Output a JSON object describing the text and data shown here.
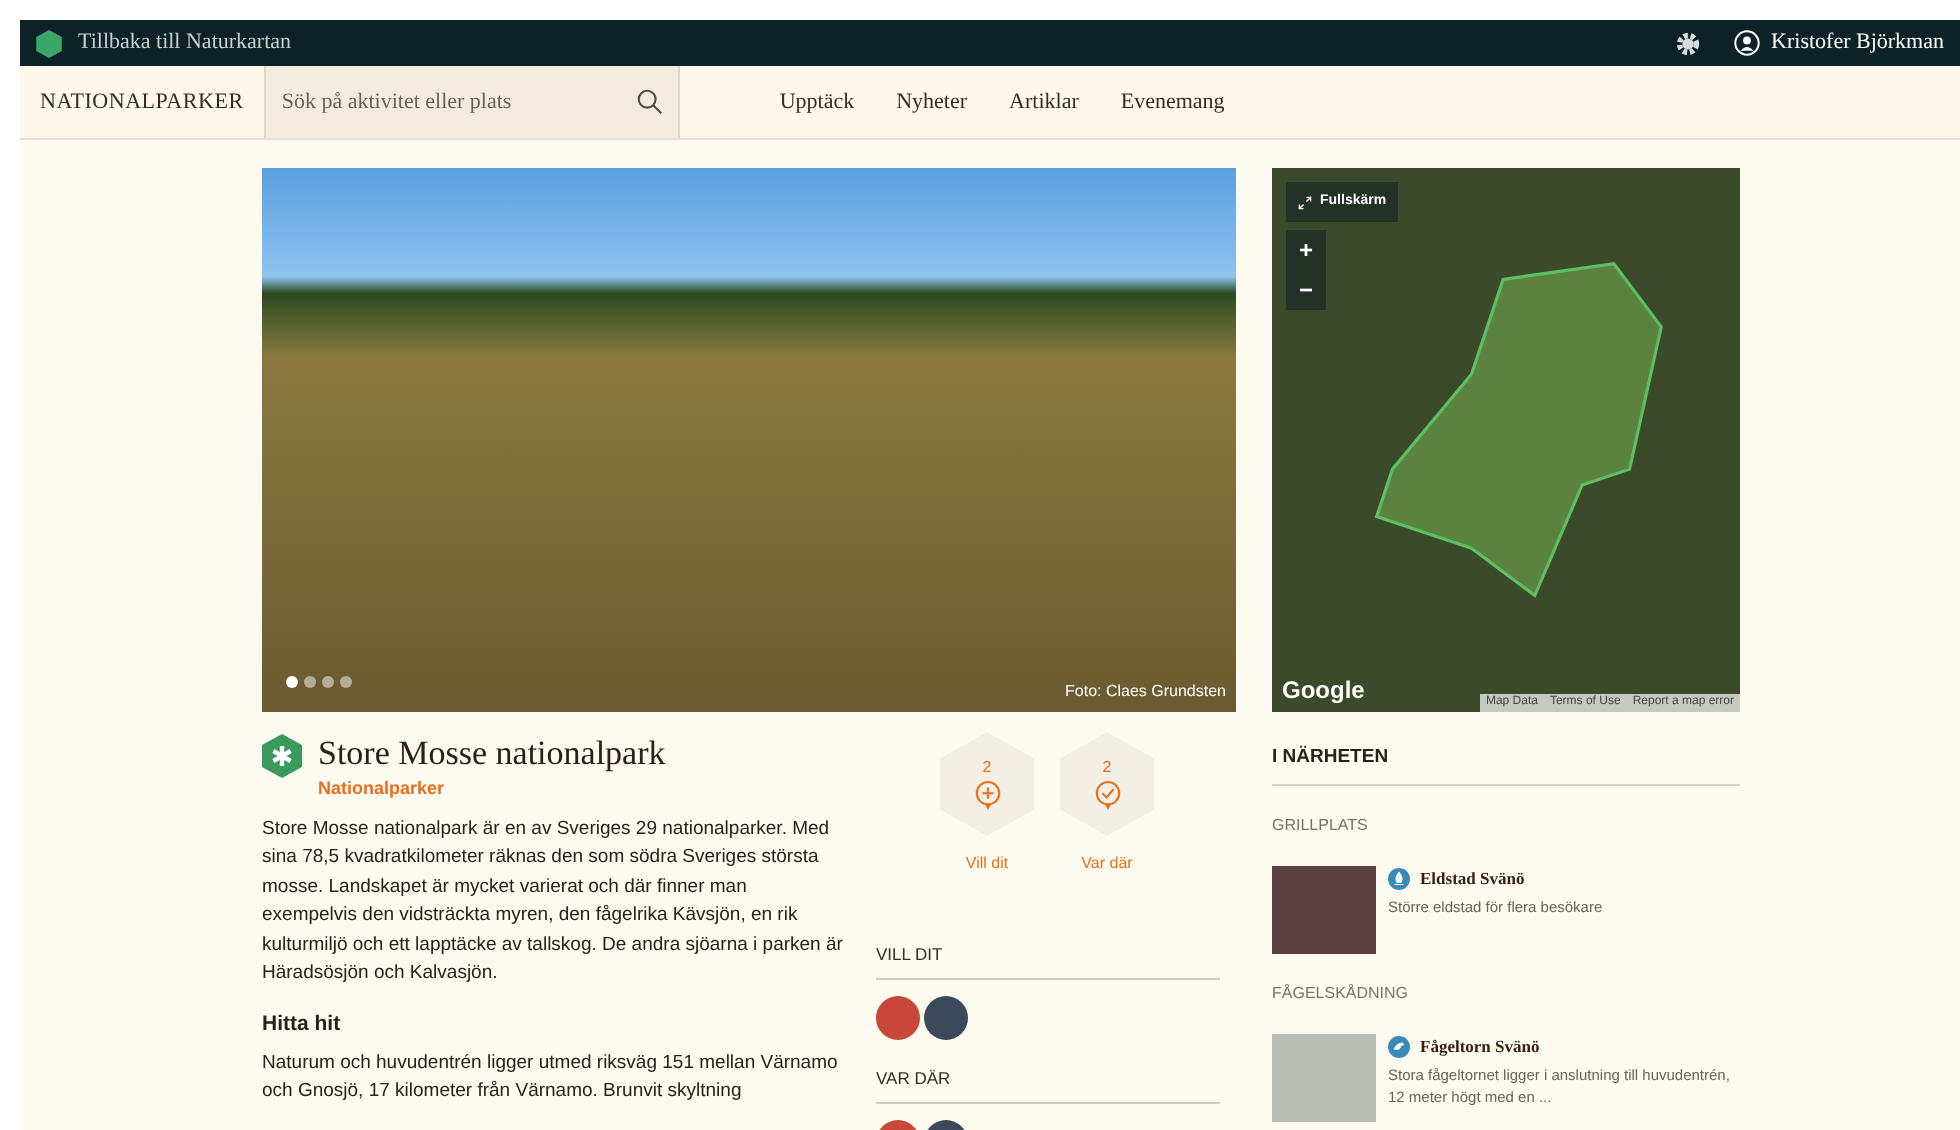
{
  "topbar": {
    "back_link": "Tillbaka till Naturkartan",
    "user": "Kristofer Björkman"
  },
  "nav": {
    "brand": "NATIONALPARKER",
    "search": {
      "placeholder": "Sök på aktivitet eller plats"
    },
    "links": [
      "Upptäck",
      "Nyheter",
      "Artiklar",
      "Evenemang"
    ]
  },
  "photo": {
    "caption": "Foto: Claes Grundsten",
    "dots": [
      {
        "selected": true
      },
      {
        "selected": false
      },
      {
        "selected": false
      },
      {
        "selected": false
      }
    ]
  },
  "map": {
    "fullscreen": "Fullskärm",
    "zoom_in": "+",
    "zoom_out": "−",
    "logo": "Google",
    "footer_links": [
      "Map Data",
      "Terms of Use",
      "Report a map error"
    ]
  },
  "park": {
    "title": "Store Mosse nationalpark",
    "category": "Nationalparker",
    "description": "Store Mosse nationalpark är en av Sveriges 29 nationalparker. Med sina 78,5 kvadratkilometer räknas den som södra Sveriges största mosse. Landskapet är mycket varierat och där finner man exempelvis den vidsträckta myren, den fågelrika Kävsjön, en rik kulturmiljö och ett lapptäcke av tallskog. De andra sjöarna i parken är Häradsösjön och Kalvasjön.",
    "directions_heading": "Hitta hit",
    "directions": "Naturum och huvudentrén ligger utmed riksväg 151 mellan Värnamo och Gnosjö, 17 kilometer från Värnamo. Brunvit skyltning"
  },
  "actions": [
    {
      "kind": "want",
      "count": "2",
      "label": "Vill dit"
    },
    {
      "kind": "been",
      "count": "2",
      "label": "Var där"
    }
  ],
  "visitor_groups": [
    {
      "heading": "VILL DIT"
    },
    {
      "heading": "VAR DÄR"
    }
  ],
  "nearby": {
    "heading": "I NÄRHETEN",
    "groups": [
      {
        "category": "GRILLPLATS",
        "items": [
          {
            "kind": "fire",
            "title": "Eldstad Svänö",
            "text": "Större eldstad för flera besökare"
          }
        ]
      },
      {
        "category": "FÅGELSKÅDNING",
        "items": [
          {
            "kind": "bird",
            "title": "Fågeltorn Svänö",
            "text": "Stora fågeltornet ligger i anslutning till huvudentrén, 12 meter högt med en ..."
          }
        ]
      }
    ]
  }
}
